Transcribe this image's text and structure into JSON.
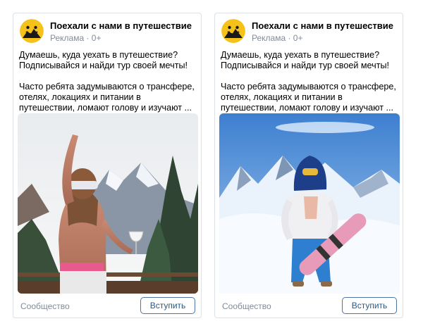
{
  "cards": [
    {
      "title": "Поехали с нами в путешествие",
      "subtitle": "Реклама · 0+",
      "text_line1": "Думаешь, куда уехать в путешествие? Подписывайся и найди тур своей мечты!",
      "text_line2": "Часто ребята задумываются о трансфере, отелях, локациях и питании в путешествии, ломают голову и изучают ...",
      "footer_label": "Сообщество",
      "join_label": "Вступить",
      "photo": "woman-with-wine-glass-mountains-photo"
    },
    {
      "title": "Поехали с нами в путешествие",
      "subtitle": "Реклама · 0+",
      "text_line1": "Думаешь, куда уехать в путешествие? Подписывайся и найди тур своей мечты!",
      "text_line2": "Часто ребята задумываются о трансфере, отелях, локациях и питании в путешествии, ломают голову и изучают ...",
      "footer_label": "Сообщество",
      "join_label": "Вступить",
      "photo": "snowboarder-mountains-photo"
    }
  ],
  "colors": {
    "accent": "#4a76a8",
    "muted": "#818c99",
    "avatar_bg": "#f5c21b"
  }
}
